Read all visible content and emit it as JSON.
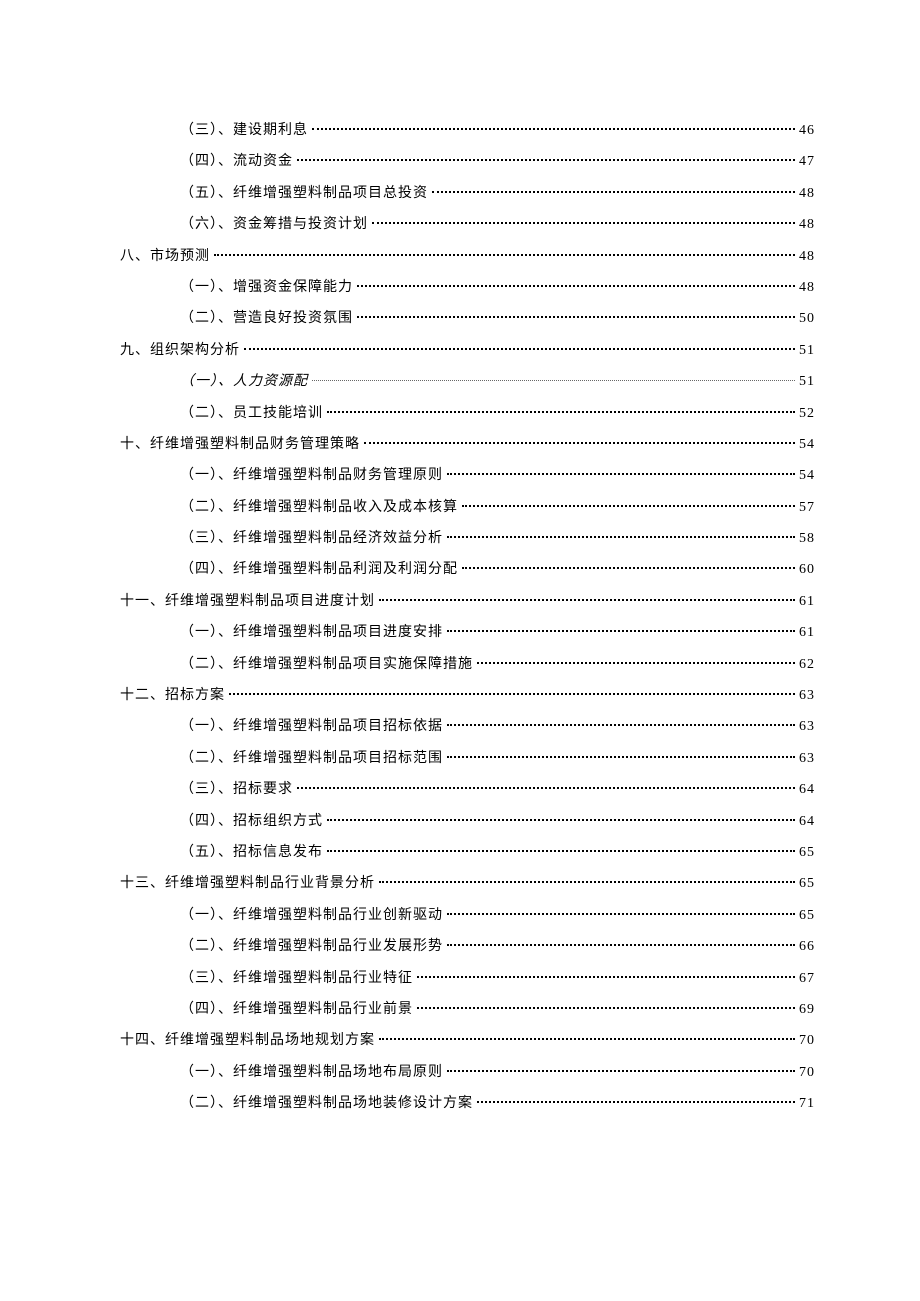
{
  "toc": [
    {
      "level": 2,
      "label": "（三）、建设期利息",
      "page": "46",
      "italic": false,
      "smooth": false
    },
    {
      "level": 2,
      "label": "（四）、流动资金",
      "page": "47",
      "italic": false,
      "smooth": false
    },
    {
      "level": 2,
      "label": "（五）、纤维增强塑料制品项目总投资",
      "page": "48",
      "italic": false,
      "smooth": false
    },
    {
      "level": 2,
      "label": "（六）、资金筹措与投资计划",
      "page": "48",
      "italic": false,
      "smooth": false
    },
    {
      "level": 1,
      "label": "八、市场预测",
      "page": "48",
      "italic": false,
      "smooth": false
    },
    {
      "level": 2,
      "label": "（一）、增强资金保障能力",
      "page": "48",
      "italic": false,
      "smooth": false
    },
    {
      "level": 2,
      "label": "（二）、营造良好投资氛围",
      "page": "50",
      "italic": false,
      "smooth": false
    },
    {
      "level": 1,
      "label": "九、组织架构分析",
      "page": "51",
      "italic": false,
      "smooth": false
    },
    {
      "level": 2,
      "label": "（一）、人力资源配",
      "page": "51",
      "italic": true,
      "smooth": true
    },
    {
      "level": 2,
      "label": "（二）、员工技能培训",
      "page": "52",
      "italic": false,
      "smooth": false
    },
    {
      "level": 1,
      "label": "十、纤维增强塑料制品财务管理策略",
      "page": "54",
      "italic": false,
      "smooth": false
    },
    {
      "level": 2,
      "label": "（一）、纤维增强塑料制品财务管理原则",
      "page": "54",
      "italic": false,
      "smooth": false
    },
    {
      "level": 2,
      "label": "（二）、纤维增强塑料制品收入及成本核算",
      "page": "57",
      "italic": false,
      "smooth": false
    },
    {
      "level": 2,
      "label": "（三）、纤维增强塑料制品经济效益分析",
      "page": "58",
      "italic": false,
      "smooth": false
    },
    {
      "level": 2,
      "label": "（四）、纤维增强塑料制品利润及利润分配",
      "page": "60",
      "italic": false,
      "smooth": false
    },
    {
      "level": 1,
      "label": "十一、纤维增强塑料制品项目进度计划",
      "page": "61",
      "italic": false,
      "smooth": false
    },
    {
      "level": 2,
      "label": "（一）、纤维增强塑料制品项目进度安排",
      "page": "61",
      "italic": false,
      "smooth": false
    },
    {
      "level": 2,
      "label": "（二）、纤维增强塑料制品项目实施保障措施",
      "page": "62",
      "italic": false,
      "smooth": false
    },
    {
      "level": 1,
      "label": "十二、招标方案",
      "page": "63",
      "italic": false,
      "smooth": false
    },
    {
      "level": 2,
      "label": "（一）、纤维增强塑料制品项目招标依据",
      "page": "63",
      "italic": false,
      "smooth": false
    },
    {
      "level": 2,
      "label": "（二）、纤维增强塑料制品项目招标范围",
      "page": "63",
      "italic": false,
      "smooth": false
    },
    {
      "level": 2,
      "label": "（三）、招标要求",
      "page": "64",
      "italic": false,
      "smooth": false
    },
    {
      "level": 2,
      "label": "（四）、招标组织方式",
      "page": "64",
      "italic": false,
      "smooth": false
    },
    {
      "level": 2,
      "label": "（五）、招标信息发布",
      "page": "65",
      "italic": false,
      "smooth": false
    },
    {
      "level": 1,
      "label": "十三、纤维增强塑料制品行业背景分析",
      "page": "65",
      "italic": false,
      "smooth": false
    },
    {
      "level": 2,
      "label": "（一）、纤维增强塑料制品行业创新驱动",
      "page": "65",
      "italic": false,
      "smooth": false
    },
    {
      "level": 2,
      "label": "（二）、纤维增强塑料制品行业发展形势",
      "page": "66",
      "italic": false,
      "smooth": false
    },
    {
      "level": 2,
      "label": "（三）、纤维增强塑料制品行业特征",
      "page": "67",
      "italic": false,
      "smooth": false
    },
    {
      "level": 2,
      "label": "（四）、纤维增强塑料制品行业前景",
      "page": "69",
      "italic": false,
      "smooth": false
    },
    {
      "level": 1,
      "label": "十四、纤维增强塑料制品场地规划方案",
      "page": "70",
      "italic": false,
      "smooth": false
    },
    {
      "level": 2,
      "label": "（一）、纤维增强塑料制品场地布局原则",
      "page": "70",
      "italic": false,
      "smooth": false
    },
    {
      "level": 2,
      "label": "（二）、纤维增强塑料制品场地装修设计方案",
      "page": "71",
      "italic": false,
      "smooth": false
    }
  ]
}
